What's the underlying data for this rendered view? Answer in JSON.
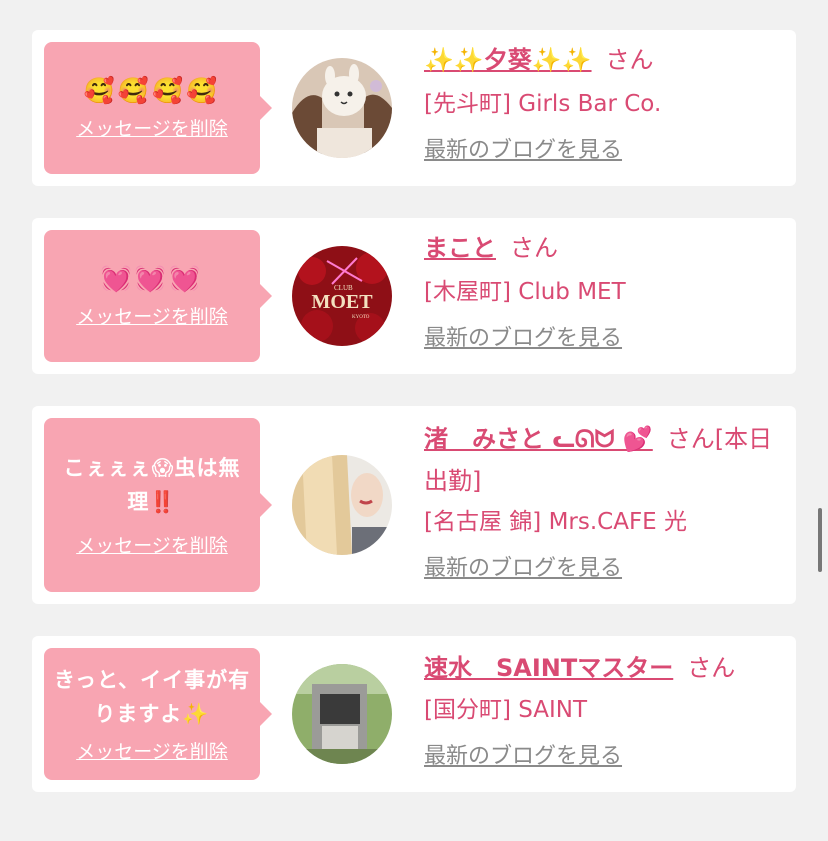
{
  "cards": [
    {
      "message": "🥰🥰🥰🥰",
      "delete_label": "メッセージを削除",
      "name": "✨✨夕葵✨✨",
      "honorific": "さん",
      "shop": "[先斗町] Girls Bar Co.",
      "blog_link": "最新のブログを見る"
    },
    {
      "message": "💓💓💓",
      "delete_label": "メッセージを削除",
      "name": "まこと",
      "honorific": "さん",
      "shop": "[木屋町] Club MET",
      "blog_link": "最新のブログを見る",
      "avatar_logo_top": "CLUB",
      "avatar_logo_main": "MOET",
      "avatar_logo_sub": "KYOTO"
    },
    {
      "message": "こぇぇぇ😱虫は無理‼️",
      "delete_label": "メッセージを削除",
      "name": "渚　みさと ᓚᘏᗢ 💕",
      "honorific": "さん[本日出勤]",
      "shop": "[名古屋 錦] Mrs.CAFE 光",
      "blog_link": "最新のブログを見る"
    },
    {
      "message": "きっと、イイ事が有りますよ✨",
      "delete_label": "メッセージを削除",
      "name": "速水　SAINTマスター",
      "honorific": "さん",
      "shop": "[国分町] SAINT",
      "blog_link": "最新のブログを見る"
    }
  ],
  "colors": {
    "background": "#f1f1f1",
    "card": "#ffffff",
    "bubble": "#f8a5b2",
    "accent": "#d94a73",
    "link_gray": "#8a8a8a"
  }
}
